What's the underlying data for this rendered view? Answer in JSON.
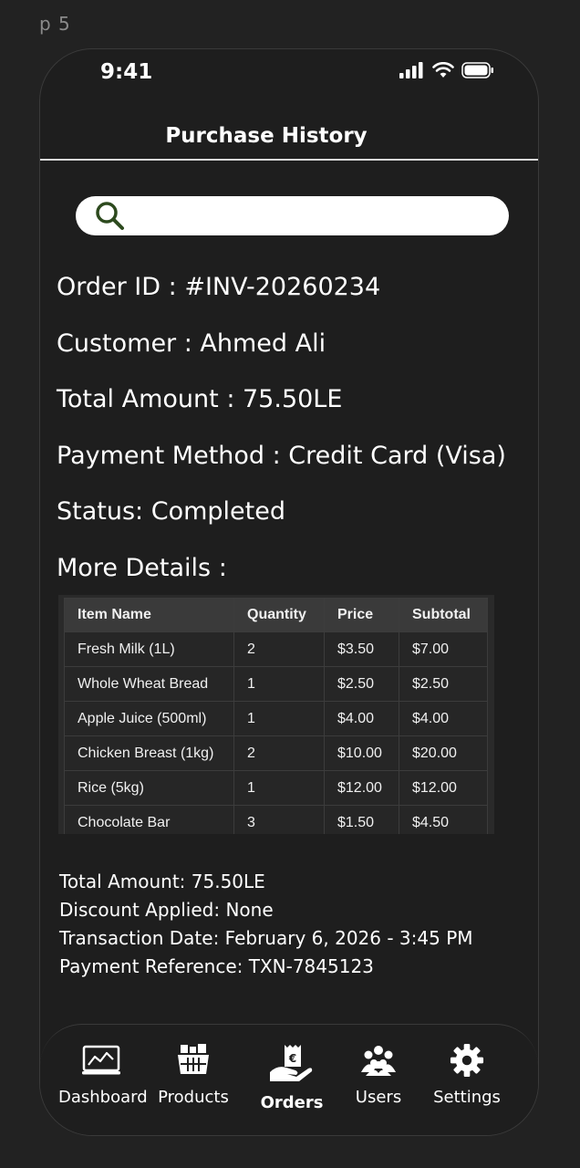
{
  "frame_label": "p 5",
  "status_bar": {
    "time": "9:41"
  },
  "header": {
    "title": "Purchase History"
  },
  "search": {
    "placeholder": "",
    "icon": "search-icon"
  },
  "order": {
    "order_id": "Order ID :   #INV-20260234",
    "customer": "Customer : Ahmed Ali",
    "total": "Total Amount : 75.50LE",
    "payment": "Payment Method : Credit Card (Visa)",
    "status": "Status:  Completed",
    "more_details": "More Details :"
  },
  "items_table": {
    "headers": [
      "Item Name",
      "Quantity",
      "Price",
      "Subtotal"
    ],
    "rows": [
      [
        "Fresh Milk (1L)",
        "2",
        "$3.50",
        "$7.00"
      ],
      [
        "Whole Wheat Bread",
        "1",
        "$2.50",
        "$2.50"
      ],
      [
        "Apple Juice (500ml)",
        "1",
        "$4.00",
        "$4.00"
      ],
      [
        "Chicken Breast (1kg)",
        "2",
        "$10.00",
        "$20.00"
      ],
      [
        "Rice (5kg)",
        "1",
        "$12.00",
        "$12.00"
      ],
      [
        "Chocolate Bar",
        "3",
        "$1.50",
        "$4.50"
      ]
    ]
  },
  "summary": {
    "total": "Total Amount: 75.50LE",
    "discount": "Discount Applied: None",
    "date": "Transaction Date: February 6, 2026 - 3:45 PM",
    "reference": "Payment Reference: TXN-7845123"
  },
  "tabs": [
    {
      "label": "Dashboard",
      "icon": "dashboard-icon"
    },
    {
      "label": "Products",
      "icon": "products-icon"
    },
    {
      "label": "Orders",
      "icon": "orders-icon",
      "active": true
    },
    {
      "label": "Users",
      "icon": "users-icon"
    },
    {
      "label": "Settings",
      "icon": "gear-icon"
    }
  ],
  "colors": {
    "background": "#1e1e1e",
    "search_icon": "#2d4a1e"
  }
}
